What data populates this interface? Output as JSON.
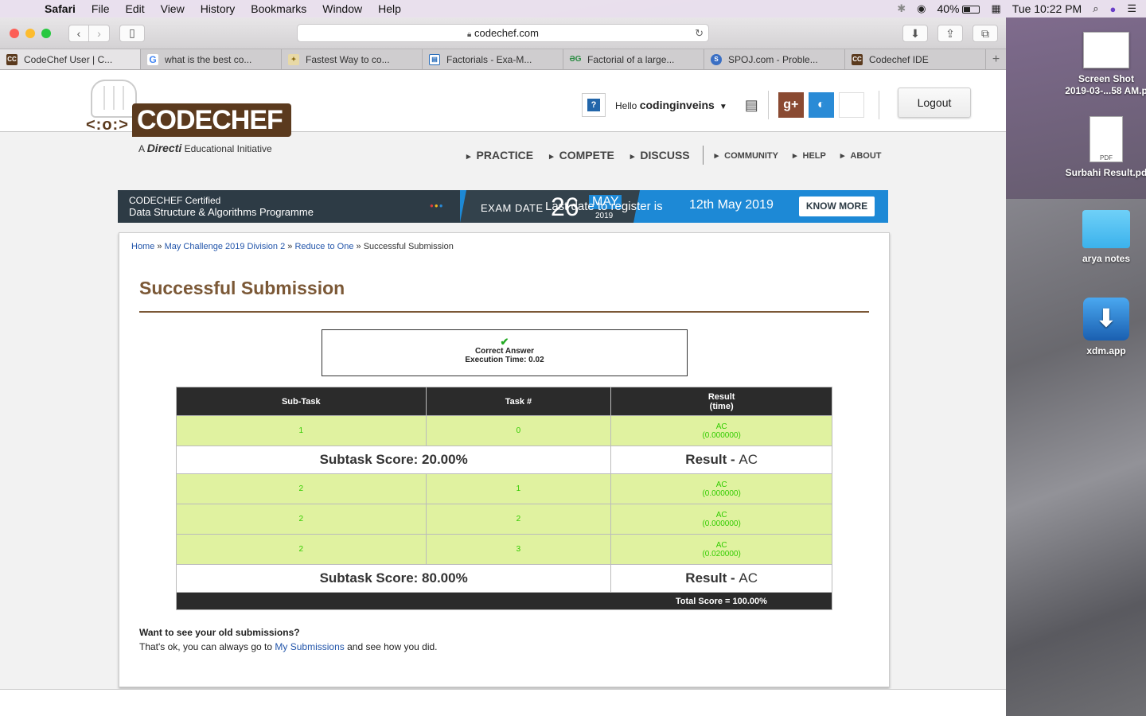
{
  "menubar": {
    "app": "Safari",
    "menus": [
      "File",
      "Edit",
      "View",
      "History",
      "Bookmarks",
      "Window",
      "Help"
    ],
    "battery": "40%",
    "clock": "Tue 10:22 PM"
  },
  "browser": {
    "url": "codechef.com",
    "tabs": [
      {
        "title": "CodeChef User | C...",
        "favicon": "CC",
        "color": "#5b3a1e"
      },
      {
        "title": "what is the best co...",
        "favicon": "G",
        "color": "#4285f4"
      },
      {
        "title": "Fastest Way to co...",
        "favicon": "bulb",
        "color": "#c9a33a"
      },
      {
        "title": "Factorials - Exa-M...",
        "favicon": "grid",
        "color": "#2a6ebb"
      },
      {
        "title": "Factorial of a large...",
        "favicon": "GG",
        "color": "#2f8d46"
      },
      {
        "title": "SPOJ.com - Proble...",
        "favicon": "S",
        "color": "#3a6fc4"
      },
      {
        "title": "Codechef IDE",
        "favicon": "CC",
        "color": "#5b3a1e"
      }
    ]
  },
  "site": {
    "logo_text": "CODECHEF",
    "logo_face": "<:o:>",
    "tagline_a": "A",
    "tagline_brand": "Directi",
    "tagline_rest": "Educational Initiative",
    "hello": "Hello",
    "username": "codinginveins",
    "logout": "Logout",
    "nav_main": [
      "PRACTICE",
      "COMPETE",
      "DISCUSS"
    ],
    "nav_sub": [
      "COMMUNITY",
      "HELP",
      "ABOUT"
    ]
  },
  "banner": {
    "certified": "CODECHEF Certified",
    "programme": "Data Structure & Algorithms Programme",
    "exam_label": "EXAM DATE",
    "exam_day": "26",
    "exam_month": "MAY",
    "exam_year": "2019",
    "last_date": "Last date to register is",
    "register_date": "12th May 2019",
    "cta": "KNOW MORE"
  },
  "breadcrumb": {
    "items": [
      "Home",
      "May Challenge 2019 Division 2",
      "Reduce to One"
    ],
    "current": "Successful Submission",
    "sep": " » "
  },
  "submission": {
    "title": "Successful Submission",
    "verdict": "Correct Answer",
    "exec_time": "Execution Time: 0.02",
    "headers": [
      "Sub-Task",
      "Task #",
      "Result\n(time)"
    ],
    "groups": [
      {
        "rows": [
          {
            "subtask": "1",
            "task": "0",
            "result": "AC",
            "time": "(0.000000)"
          }
        ],
        "score": "Subtask Score: 20.00%",
        "result_label": "Result - ",
        "result": "AC"
      },
      {
        "rows": [
          {
            "subtask": "2",
            "task": "1",
            "result": "AC",
            "time": "(0.000000)"
          },
          {
            "subtask": "2",
            "task": "2",
            "result": "AC",
            "time": "(0.000000)"
          },
          {
            "subtask": "2",
            "task": "3",
            "result": "AC",
            "time": "(0.020000)"
          }
        ],
        "score": "Subtask Score: 80.00%",
        "result_label": "Result - ",
        "result": "AC"
      }
    ],
    "total": "Total Score = 100.00%",
    "old_q": "Want to see your old submissions?",
    "old_a": "That's ok, you can always go to",
    "old_link": "My Submissions",
    "old_tail": "and see how you did."
  },
  "desktop": {
    "icons": [
      {
        "label": "Screen Shot\n2019-03-...58 AM.p",
        "kind": "screenshot"
      },
      {
        "label": "Surbahi Result.pd",
        "kind": "pdf",
        "badge": "PDF"
      },
      {
        "label": "arya notes",
        "kind": "folder"
      },
      {
        "label": "xdm.app",
        "kind": "app"
      }
    ]
  }
}
